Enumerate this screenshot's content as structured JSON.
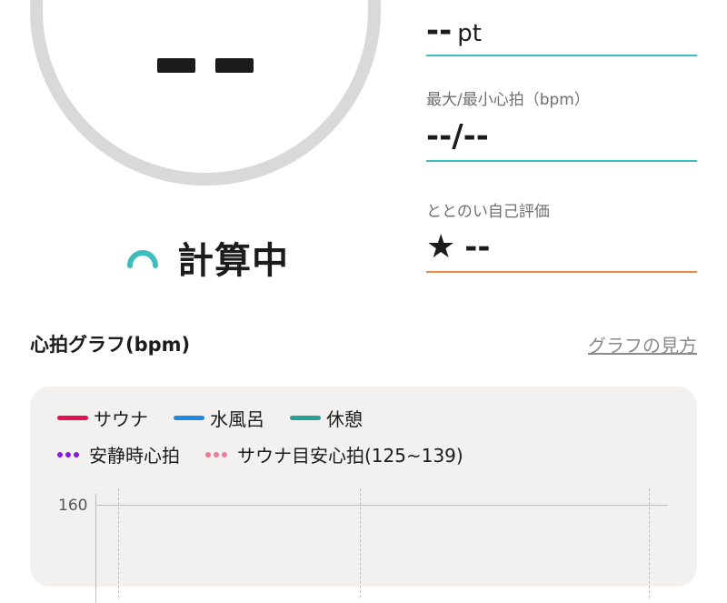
{
  "score": {
    "status_label": "計算中"
  },
  "stats": {
    "points": {
      "value": "--",
      "unit": "pt"
    },
    "heart_rate": {
      "label": "最大/最小心拍（bpm）",
      "value": "--/--"
    },
    "self_rating": {
      "label": "ととのい自己評価",
      "star": "★",
      "value": "--"
    }
  },
  "graph": {
    "title": "心拍グラフ(bpm)",
    "help_link": "グラフの見方",
    "legend": {
      "sauna": "サウナ",
      "water_bath": "水風呂",
      "rest": "休憩",
      "resting_hr": "安静時心拍",
      "sauna_target_hr": "サウナ目安心拍(125~139)"
    },
    "y_tick": "160"
  },
  "colors": {
    "sauna": "#e5104f",
    "water_bath": "#1e88e5",
    "rest": "#26a09b",
    "resting_hr": "#8a17e6",
    "sauna_target_hr": "#f07a9a",
    "accent": "#3fbcbd",
    "rating_underline": "#ee8a3c"
  }
}
